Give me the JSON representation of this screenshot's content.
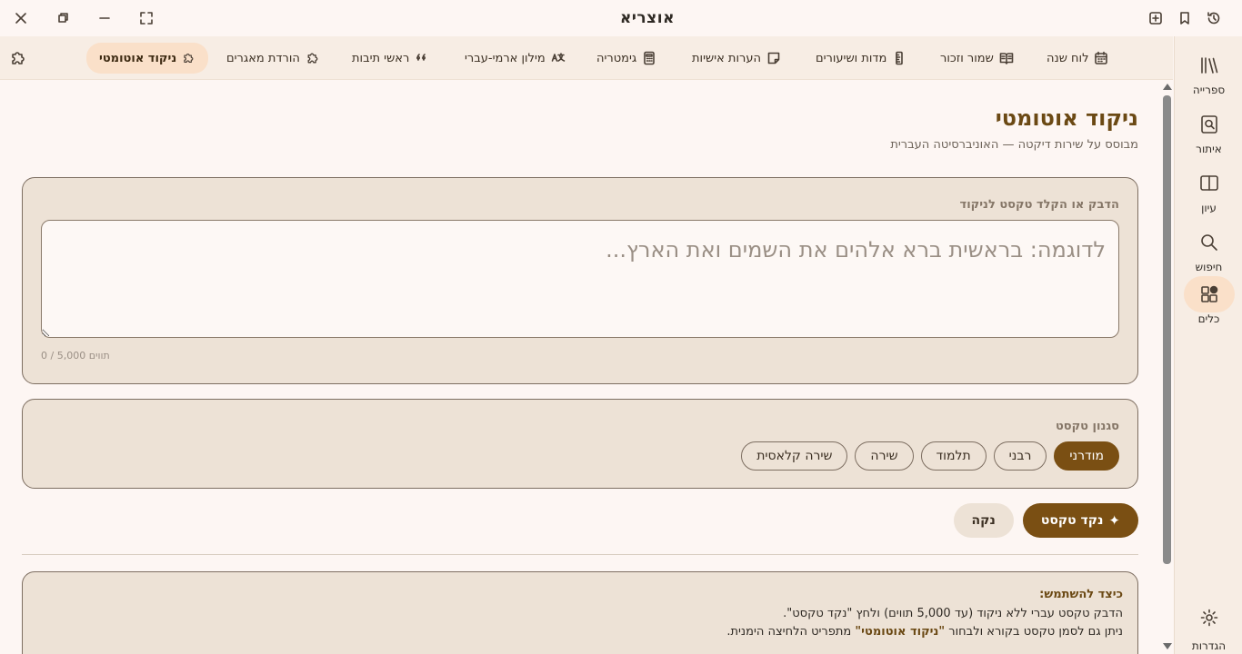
{
  "window": {
    "title": "אוצריא"
  },
  "nav": {
    "items": [
      {
        "label": "לוח שנה",
        "icon": "calendar-icon"
      },
      {
        "label": "שמור וזכור",
        "icon": "book-open-icon"
      },
      {
        "label": "מדות ושיעורים",
        "icon": "ruler-icon"
      },
      {
        "label": "הערות אישיות",
        "icon": "note-icon"
      },
      {
        "label": "גימטריה",
        "icon": "calculator-icon"
      },
      {
        "label": "מילון ארמי-עברי",
        "icon": "translate-icon"
      },
      {
        "label": "ראשי תיבות",
        "icon": "quote-icon"
      },
      {
        "label": "הורדת מאגרים",
        "icon": "puzzle-icon"
      },
      {
        "label": "ניקוד אוטומטי",
        "icon": "puzzle-icon",
        "active": true
      }
    ]
  },
  "sidebar": {
    "items": [
      {
        "label": "ספרייה",
        "icon": "library-icon"
      },
      {
        "label": "איתור",
        "icon": "find-book-icon"
      },
      {
        "label": "עיון",
        "icon": "reading-icon"
      },
      {
        "label": "חיפוש",
        "icon": "search-icon"
      },
      {
        "label": "כלים",
        "icon": "tools-icon",
        "active": true
      }
    ],
    "settings_label": "הגדרות"
  },
  "main": {
    "title": "ניקוד אוטומטי",
    "subtitle": "מבוסס על שירות דיקטה — האוניברסיטה העברית",
    "input": {
      "label": "הדבק או הקלד טקסט לניקוד",
      "placeholder": "לדוגמה: בראשית ברא אלהים את השמים ואת הארץ...",
      "value": "",
      "counter": "0 / 5,000 תווים"
    },
    "style": {
      "label": "סגנון טקסט",
      "options": [
        "מודרני",
        "רבני",
        "תלמוד",
        "שירה",
        "שירה קלאסית"
      ],
      "selected": "מודרני"
    },
    "actions": {
      "nakked_label": "נקד טקסט",
      "nakked_icon": "sparkle-icon",
      "clear_label": "נקה"
    },
    "help": {
      "title": "כיצד להשתמש:",
      "line1": "הדבק טקסט עברי ללא ניקוד (עד 5,000 תווים) ולחץ \"נקד טקסט\".",
      "line2_pre": "ניתן גם לסמן טקסט בקורא ולבחור ",
      "line2_bold": "\"ניקוד אוטומטי\"",
      "line2_post": " מתפריט הלחיצה הימנית."
    }
  },
  "colors": {
    "accent": "#7a4f13",
    "accent_light": "#fae0c9",
    "title": "#6b4914",
    "card": "#ede2d6",
    "background": "#fdf6f3"
  }
}
